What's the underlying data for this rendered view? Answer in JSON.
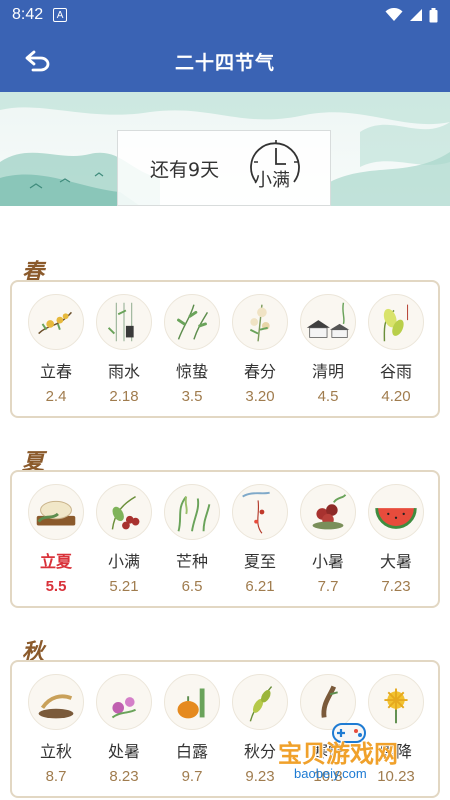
{
  "status_bar": {
    "time": "8:42",
    "notification_icon": "A"
  },
  "app_bar": {
    "title": "二十四节气",
    "back_icon": "back-arrow-icon"
  },
  "banner": {
    "countdown_text": "还有9天",
    "next_term": "小满",
    "clock_icon": "clock-icon"
  },
  "seasons": [
    {
      "title": "春",
      "terms": [
        {
          "name": "立春",
          "date": "2.4"
        },
        {
          "name": "雨水",
          "date": "2.18"
        },
        {
          "name": "惊蛰",
          "date": "3.5"
        },
        {
          "name": "春分",
          "date": "3.20"
        },
        {
          "name": "清明",
          "date": "4.5"
        },
        {
          "name": "谷雨",
          "date": "4.20"
        }
      ]
    },
    {
      "title": "夏",
      "terms": [
        {
          "name": "立夏",
          "date": "5.5",
          "active": true
        },
        {
          "name": "小满",
          "date": "5.21"
        },
        {
          "name": "芒种",
          "date": "6.5"
        },
        {
          "name": "夏至",
          "date": "6.21"
        },
        {
          "name": "小暑",
          "date": "7.7"
        },
        {
          "name": "大暑",
          "date": "7.23"
        }
      ]
    },
    {
      "title": "秋",
      "terms": [
        {
          "name": "立秋",
          "date": "8.7"
        },
        {
          "name": "处暑",
          "date": "8.23"
        },
        {
          "name": "白露",
          "date": "9.7"
        },
        {
          "name": "秋分",
          "date": "9.23"
        },
        {
          "name": "寒露",
          "date": "10.8"
        },
        {
          "name": "霜降",
          "date": "10.23"
        }
      ]
    }
  ],
  "watermark": {
    "text": "宝贝游戏网",
    "url": "baobeiy.com"
  },
  "colors": {
    "primary": "#3a63b4",
    "active": "#d9323a",
    "date": "#a07c4e",
    "season_title": "#8b5a2b",
    "card_border": "#e2d7c3"
  }
}
